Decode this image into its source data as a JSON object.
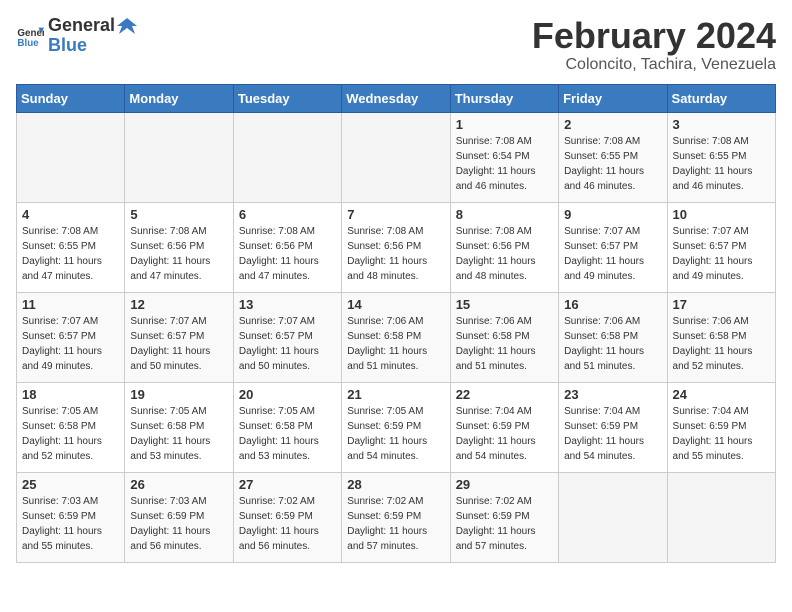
{
  "header": {
    "logo_general": "General",
    "logo_blue": "Blue",
    "title": "February 2024",
    "subtitle": "Coloncito, Tachira, Venezuela"
  },
  "days_of_week": [
    "Sunday",
    "Monday",
    "Tuesday",
    "Wednesday",
    "Thursday",
    "Friday",
    "Saturday"
  ],
  "weeks": [
    [
      {
        "day": "",
        "info": ""
      },
      {
        "day": "",
        "info": ""
      },
      {
        "day": "",
        "info": ""
      },
      {
        "day": "",
        "info": ""
      },
      {
        "day": "1",
        "info": "Sunrise: 7:08 AM\nSunset: 6:54 PM\nDaylight: 11 hours\nand 46 minutes."
      },
      {
        "day": "2",
        "info": "Sunrise: 7:08 AM\nSunset: 6:55 PM\nDaylight: 11 hours\nand 46 minutes."
      },
      {
        "day": "3",
        "info": "Sunrise: 7:08 AM\nSunset: 6:55 PM\nDaylight: 11 hours\nand 46 minutes."
      }
    ],
    [
      {
        "day": "4",
        "info": "Sunrise: 7:08 AM\nSunset: 6:55 PM\nDaylight: 11 hours\nand 47 minutes."
      },
      {
        "day": "5",
        "info": "Sunrise: 7:08 AM\nSunset: 6:56 PM\nDaylight: 11 hours\nand 47 minutes."
      },
      {
        "day": "6",
        "info": "Sunrise: 7:08 AM\nSunset: 6:56 PM\nDaylight: 11 hours\nand 47 minutes."
      },
      {
        "day": "7",
        "info": "Sunrise: 7:08 AM\nSunset: 6:56 PM\nDaylight: 11 hours\nand 48 minutes."
      },
      {
        "day": "8",
        "info": "Sunrise: 7:08 AM\nSunset: 6:56 PM\nDaylight: 11 hours\nand 48 minutes."
      },
      {
        "day": "9",
        "info": "Sunrise: 7:07 AM\nSunset: 6:57 PM\nDaylight: 11 hours\nand 49 minutes."
      },
      {
        "day": "10",
        "info": "Sunrise: 7:07 AM\nSunset: 6:57 PM\nDaylight: 11 hours\nand 49 minutes."
      }
    ],
    [
      {
        "day": "11",
        "info": "Sunrise: 7:07 AM\nSunset: 6:57 PM\nDaylight: 11 hours\nand 49 minutes."
      },
      {
        "day": "12",
        "info": "Sunrise: 7:07 AM\nSunset: 6:57 PM\nDaylight: 11 hours\nand 50 minutes."
      },
      {
        "day": "13",
        "info": "Sunrise: 7:07 AM\nSunset: 6:57 PM\nDaylight: 11 hours\nand 50 minutes."
      },
      {
        "day": "14",
        "info": "Sunrise: 7:06 AM\nSunset: 6:58 PM\nDaylight: 11 hours\nand 51 minutes."
      },
      {
        "day": "15",
        "info": "Sunrise: 7:06 AM\nSunset: 6:58 PM\nDaylight: 11 hours\nand 51 minutes."
      },
      {
        "day": "16",
        "info": "Sunrise: 7:06 AM\nSunset: 6:58 PM\nDaylight: 11 hours\nand 51 minutes."
      },
      {
        "day": "17",
        "info": "Sunrise: 7:06 AM\nSunset: 6:58 PM\nDaylight: 11 hours\nand 52 minutes."
      }
    ],
    [
      {
        "day": "18",
        "info": "Sunrise: 7:05 AM\nSunset: 6:58 PM\nDaylight: 11 hours\nand 52 minutes."
      },
      {
        "day": "19",
        "info": "Sunrise: 7:05 AM\nSunset: 6:58 PM\nDaylight: 11 hours\nand 53 minutes."
      },
      {
        "day": "20",
        "info": "Sunrise: 7:05 AM\nSunset: 6:58 PM\nDaylight: 11 hours\nand 53 minutes."
      },
      {
        "day": "21",
        "info": "Sunrise: 7:05 AM\nSunset: 6:59 PM\nDaylight: 11 hours\nand 54 minutes."
      },
      {
        "day": "22",
        "info": "Sunrise: 7:04 AM\nSunset: 6:59 PM\nDaylight: 11 hours\nand 54 minutes."
      },
      {
        "day": "23",
        "info": "Sunrise: 7:04 AM\nSunset: 6:59 PM\nDaylight: 11 hours\nand 54 minutes."
      },
      {
        "day": "24",
        "info": "Sunrise: 7:04 AM\nSunset: 6:59 PM\nDaylight: 11 hours\nand 55 minutes."
      }
    ],
    [
      {
        "day": "25",
        "info": "Sunrise: 7:03 AM\nSunset: 6:59 PM\nDaylight: 11 hours\nand 55 minutes."
      },
      {
        "day": "26",
        "info": "Sunrise: 7:03 AM\nSunset: 6:59 PM\nDaylight: 11 hours\nand 56 minutes."
      },
      {
        "day": "27",
        "info": "Sunrise: 7:02 AM\nSunset: 6:59 PM\nDaylight: 11 hours\nand 56 minutes."
      },
      {
        "day": "28",
        "info": "Sunrise: 7:02 AM\nSunset: 6:59 PM\nDaylight: 11 hours\nand 57 minutes."
      },
      {
        "day": "29",
        "info": "Sunrise: 7:02 AM\nSunset: 6:59 PM\nDaylight: 11 hours\nand 57 minutes."
      },
      {
        "day": "",
        "info": ""
      },
      {
        "day": "",
        "info": ""
      }
    ]
  ]
}
